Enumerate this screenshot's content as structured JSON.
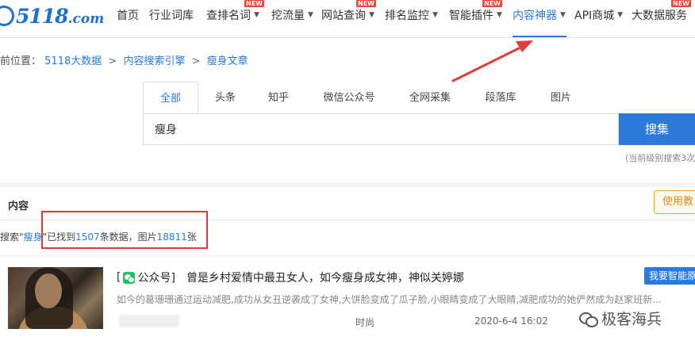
{
  "logo": {
    "text": "5118",
    "suffix": ".com"
  },
  "nav": {
    "items": [
      {
        "label": "首页",
        "caret": "",
        "new": ""
      },
      {
        "label": "行业词库",
        "caret": "",
        "new": ""
      },
      {
        "label": "查排名词",
        "caret": "▼",
        "new": "NEW"
      },
      {
        "label": "挖流量",
        "caret": "▼",
        "new": ""
      },
      {
        "label": "网站查询",
        "caret": "▼",
        "new": "NEW"
      },
      {
        "label": "排名监控",
        "caret": "▼",
        "new": ""
      },
      {
        "label": "智能插件",
        "caret": "▼",
        "new": "NEW"
      },
      {
        "label": "内容神器",
        "caret": "▼",
        "new": ""
      },
      {
        "label": "API商城",
        "caret": "▼",
        "new": ""
      },
      {
        "label": "大数据服务",
        "caret": "",
        "new": "NEW"
      }
    ]
  },
  "breadcrumb": {
    "prefix": "前位置：",
    "items": [
      "5118大数据",
      "内容搜索引擎",
      "瘦身文章"
    ],
    "sep": ">"
  },
  "search": {
    "tabs": [
      "全部",
      "头条",
      "知乎",
      "微信公众号",
      "全网采集",
      "段落库",
      "图片"
    ],
    "value": "瘦身",
    "button": "搜集",
    "level_note": "(当前级别搜索3次"
  },
  "content": {
    "tab": "内容",
    "help_button": "使用教"
  },
  "summary": {
    "p1": "搜索\"",
    "keyword": "瘦身",
    "p2": "\"已找到",
    "count": "1507",
    "p3": "条数据，图片",
    "images": "18811",
    "p4": "张"
  },
  "result": {
    "bracket_open": "[",
    "source": "公众号]",
    "title_pre": "曾是乡村爱情中最丑女人，如今",
    "title_hl": "瘦身",
    "title_post": "成女神，神似关婷娜",
    "desc": "如今的葛珊珊通过运动减肥,成功从女丑逆袭成了女神,大饼脸变成了瓜子脸,小眼睛变成了大眼睛,减肥成功的她俨然成为赵家班新...",
    "category": "时尚",
    "date": "2020-6-4 16:02",
    "ai_button": "我要智能原"
  },
  "watermark": {
    "text": "极客海兵"
  },
  "colors": {
    "accent": "#2b7ad9",
    "badge": "#e8463b",
    "annotation": "#d93a3a"
  }
}
